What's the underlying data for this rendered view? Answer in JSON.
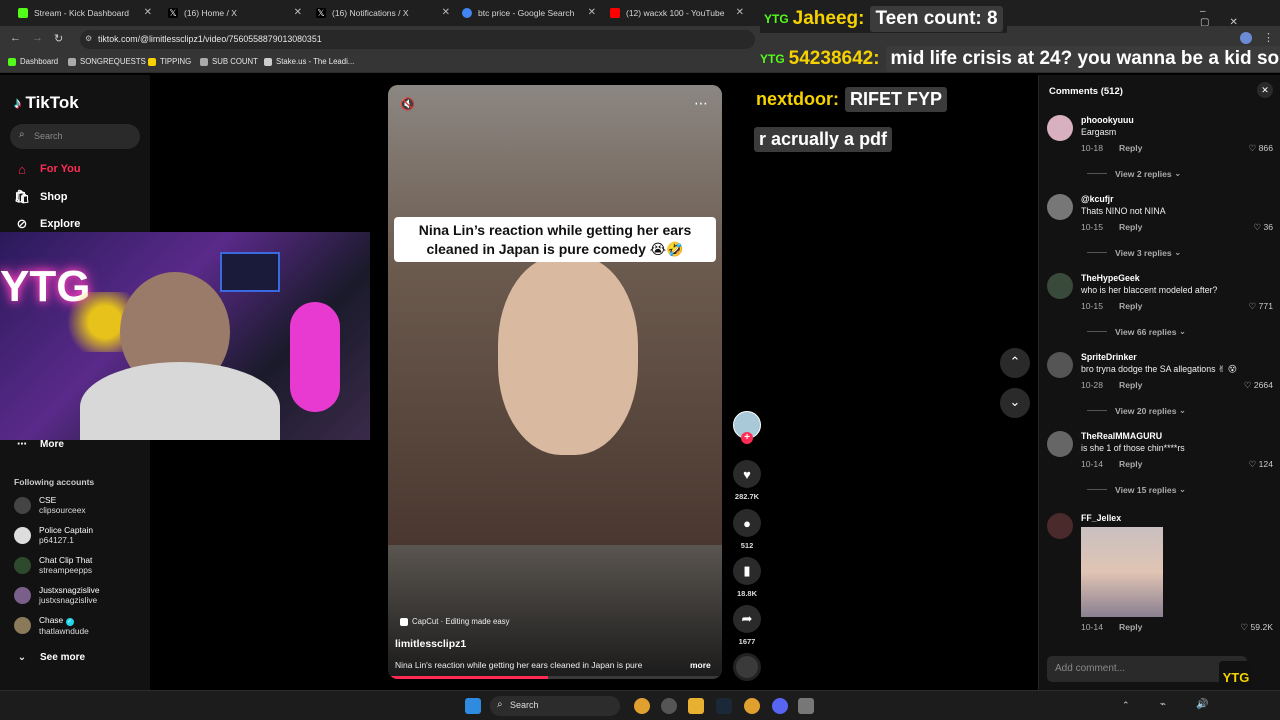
{
  "tabs": [
    {
      "title": "Stream - Kick Dashboard",
      "color": "#53fc18"
    },
    {
      "title": "(16) Home / X",
      "color": "#ffffff"
    },
    {
      "title": "(16) Notifications / X",
      "color": "#ffffff"
    },
    {
      "title": "btc price - Google Search",
      "color": "#4285f4"
    },
    {
      "title": "(12) wacxk 100 - YouTube",
      "color": "#ff0000"
    }
  ],
  "address": {
    "url": "tiktok.com/@limitlessclipz1/video/7560558879013080351"
  },
  "bookmarks": [
    {
      "label": "Dashboard",
      "color": "#53fc18"
    },
    {
      "label": "SONGREQUESTS",
      "color": "#aaaaaa"
    },
    {
      "label": "TIPPING",
      "color": "#f5d200"
    },
    {
      "label": "SUB COUNT",
      "color": "#aaaaaa"
    },
    {
      "label": "Stake.us - The Leadi...",
      "color": "#cccccc"
    }
  ],
  "sidebar": {
    "logo": "TikTok",
    "search_placeholder": "Search",
    "nav": [
      {
        "label": "For You",
        "icon": "home-icon"
      },
      {
        "label": "Shop",
        "icon": "shop-icon"
      },
      {
        "label": "Explore",
        "icon": "compass-icon"
      }
    ],
    "more": "More",
    "following_title": "Following accounts",
    "accounts": [
      {
        "name": "CSE",
        "handle": "clipsourceex"
      },
      {
        "name": "Police Captain",
        "handle": "p64127.1"
      },
      {
        "name": "Chat Clip That",
        "handle": "streampeepps"
      },
      {
        "name": "Justxsnagzislive",
        "handle": "justxsnagzislive"
      },
      {
        "name": "Chase",
        "handle": "thatlawndude"
      }
    ],
    "see_more": "See more"
  },
  "webcam": {
    "sign_text": "YTG"
  },
  "video": {
    "caption_overlay": "Nina Lin’s reaction while getting her ears cleaned in Japan is pure comedy 😭🤣",
    "capcut_label": "CapCut · Editing made easy",
    "author": "limitlessclipz1",
    "description": "Nina Lin's reaction while getting her ears cleaned in Japan is pure",
    "more": "more"
  },
  "actions": {
    "likes": "282.7K",
    "comments": "512",
    "saves": "18.8K",
    "shares": "1677"
  },
  "chat": [
    {
      "user": "Jaheeg:",
      "message": "Teen count: 8"
    },
    {
      "user": "54238642:",
      "message": "mid life crisis at 24? you wanna be a kid so bad"
    },
    {
      "user": "nextdoor:",
      "message": "RIFET FYP"
    },
    {
      "user": "",
      "message": "r acrually a pdf"
    }
  ],
  "comments_panel": {
    "title": "Comments (512)",
    "add_placeholder": "Add comment...",
    "items": [
      {
        "user": "phoookyuuu",
        "text": "Eargasm",
        "date": "10-18",
        "reply": "Reply",
        "likes": "866",
        "replies": "View 2 replies"
      },
      {
        "user": "@kcufjr",
        "text": "Thats NINO not NINA",
        "date": "10-15",
        "reply": "Reply",
        "likes": "36",
        "replies": "View 3 replies"
      },
      {
        "user": "TheHypeGeek",
        "text": "who is her blaccent modeled after?",
        "date": "10-15",
        "reply": "Reply",
        "likes": "771",
        "replies": "View 66 replies"
      },
      {
        "user": "SpriteDrinker",
        "text": "bro tryna dodge the SA allegations ✌ 😵",
        "date": "10-28",
        "reply": "Reply",
        "likes": "2664",
        "replies": "View 20 replies"
      },
      {
        "user": "TheRealMMAGURU",
        "text": "is she 1 of those chin****rs",
        "date": "10-14",
        "reply": "Reply",
        "likes": "124",
        "replies": "View 15 replies"
      },
      {
        "user": "FF_Jellex",
        "text": "",
        "date": "10-14",
        "reply": "Reply",
        "likes": "59.2K",
        "replies": ""
      }
    ]
  },
  "taskbar": {
    "search": "Search"
  }
}
